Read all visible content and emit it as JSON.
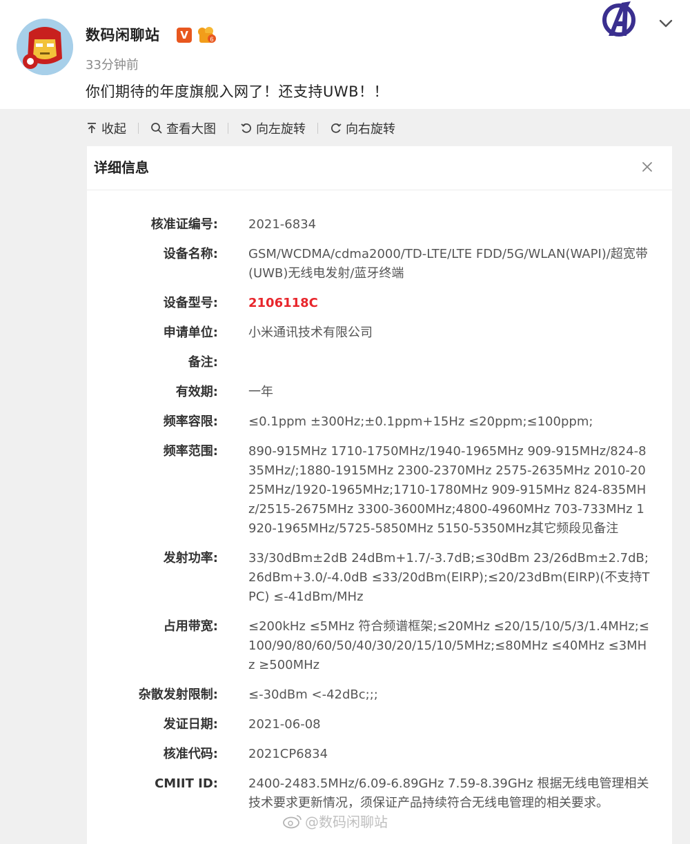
{
  "post": {
    "author": "数码闲聊站",
    "verified_badge": "V",
    "time": "33分钟前",
    "text": "你们期待的年度旗舰入网了！还支持UWB！！"
  },
  "toolbar": {
    "collapse": "收起",
    "view_large": "查看大图",
    "rotate_left": "向左旋转",
    "rotate_right": "向右旋转"
  },
  "panel": {
    "title": "详细信息",
    "rows": [
      {
        "label": "核准证编号:",
        "value": "2021-6834"
      },
      {
        "label": "设备名称:",
        "value": "GSM/WCDMA/cdma2000/TD-LTE/LTE FDD/5G/WLAN(WAPI)/超宽带(UWB)无线电发射/蓝牙终端"
      },
      {
        "label": "设备型号:",
        "value": "2106118C"
      },
      {
        "label": "申请单位:",
        "value": "小米通讯技术有限公司"
      },
      {
        "label": "备注:",
        "value": ""
      },
      {
        "label": "有效期:",
        "value": "一年"
      },
      {
        "label": "频率容限:",
        "value": "≤0.1ppm ±300Hz;±0.1ppm+15Hz ≤20ppm;≤100ppm;"
      },
      {
        "label": "频率范围:",
        "value": "890-915MHz 1710-1750MHz/1940-1965MHz 909-915MHz/824-835MHz/;1880-1915MHz 2300-2370MHz 2575-2635MHz 2010-2025MHz/1920-1965MHz;1710-1780MHz 909-915MHz 824-835MHz/2515-2675MHz 3300-3600MHz;4800-4960MHz 703-733MHz 1920-1965MHz/5725-5850MHz 5150-5350MHz其它频段见备注"
      },
      {
        "label": "发射功率:",
        "value": "33/30dBm±2dB 24dBm+1.7/-3.7dB;≤30dBm 23/26dBm±2.7dB;26dBm+3.0/-4.0dB ≤33/20dBm(EIRP);≤20/23dBm(EIRP)(不支持TPC) ≤-41dBm/MHz"
      },
      {
        "label": "占用带宽:",
        "value": "≤200kHz ≤5MHz 符合频谱框架;≤20MHz ≤20/15/10/5/3/1.4MHz;≤100/90/80/60/50/40/30/20/15/10/5MHz;≤80MHz ≤40MHz ≤3MHz ≥500MHz"
      },
      {
        "label": "杂散发射限制:",
        "value": "≤-30dBm <-42dBc;;;"
      },
      {
        "label": "发证日期:",
        "value": "2021-06-08"
      },
      {
        "label": "核准代码:",
        "value": "2021CP6834"
      },
      {
        "label": "CMIIT ID:",
        "value": "2400-2483.5MHz/6.09-6.89GHz 7.59-8.39GHz 根据无线电管理相关技术要求更新情况，须保证产品持续符合无线电管理的相关要求。"
      }
    ]
  },
  "watermark": "@数码闲聊站",
  "colors": {
    "highlight_red": "#e8252b",
    "badge_orange": "#e8571f"
  },
  "icons": [
    "iron-man-avatar",
    "verified-icon",
    "level-badge-icon",
    "avengers-logo-icon",
    "chevron-down-icon",
    "collapse-icon",
    "search-icon",
    "rotate-left-icon",
    "rotate-right-icon",
    "close-icon",
    "weibo-icon"
  ]
}
